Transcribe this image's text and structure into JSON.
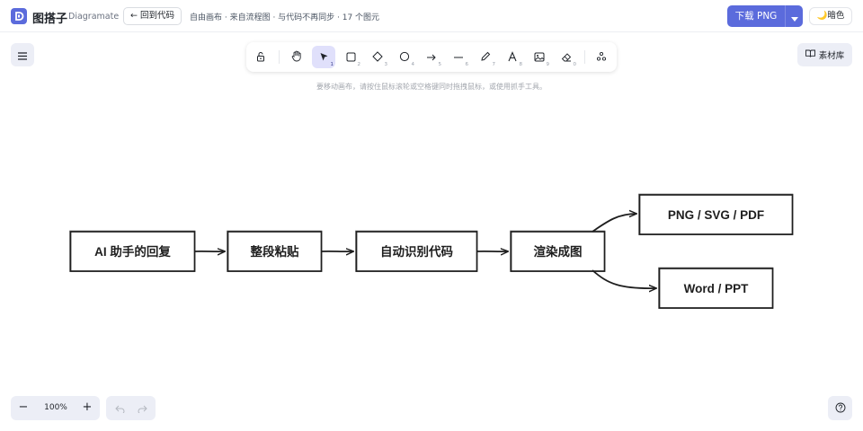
{
  "header": {
    "app_name": "图搭子",
    "app_subtitle": "Diagramate",
    "back_label": "← 回到代码",
    "status": "自由画布 · 来自流程图 · 与代码不再同步 · 17 个图元",
    "download_label": "下载 PNG",
    "theme_label": "暗色",
    "theme_icon": "moon-icon"
  },
  "library": {
    "label": "素材库",
    "icon": "book-icon"
  },
  "toolbar": {
    "tools": [
      {
        "name": "lock",
        "icon": "lock-open-icon",
        "shortcut": ""
      },
      {
        "name": "hand",
        "icon": "hand-icon",
        "shortcut": ""
      },
      {
        "name": "select",
        "icon": "cursor-icon",
        "shortcut": "1",
        "active": true
      },
      {
        "name": "rectangle",
        "icon": "rectangle-icon",
        "shortcut": "2"
      },
      {
        "name": "diamond",
        "icon": "diamond-icon",
        "shortcut": "3"
      },
      {
        "name": "ellipse",
        "icon": "ellipse-icon",
        "shortcut": "4"
      },
      {
        "name": "arrow",
        "icon": "arrow-icon",
        "shortcut": "5"
      },
      {
        "name": "line",
        "icon": "line-icon",
        "shortcut": "6"
      },
      {
        "name": "draw",
        "icon": "pencil-icon",
        "shortcut": "7"
      },
      {
        "name": "text",
        "icon": "text-icon",
        "shortcut": "8"
      },
      {
        "name": "image",
        "icon": "image-icon",
        "shortcut": "9"
      },
      {
        "name": "eraser",
        "icon": "eraser-icon",
        "shortcut": "0"
      },
      {
        "name": "more",
        "icon": "shapes-icon",
        "shortcut": ""
      }
    ],
    "hint": "要移动画布，请按住鼠标滚轮或空格键同时拖拽鼠标，或使用抓手工具。"
  },
  "diagram": {
    "nodes": [
      {
        "id": "n1",
        "label": "AI 助手的回复"
      },
      {
        "id": "n2",
        "label": "整段粘贴"
      },
      {
        "id": "n3",
        "label": "自动识别代码"
      },
      {
        "id": "n4",
        "label": "渲染成图"
      },
      {
        "id": "n5",
        "label": "PNG / SVG / PDF"
      },
      {
        "id": "n6",
        "label": "Word / PPT"
      }
    ],
    "edges": [
      {
        "from": "n1",
        "to": "n2"
      },
      {
        "from": "n2",
        "to": "n3"
      },
      {
        "from": "n3",
        "to": "n4"
      },
      {
        "from": "n4",
        "to": "n5"
      },
      {
        "from": "n4",
        "to": "n6"
      }
    ]
  },
  "footer": {
    "zoom_out": "−",
    "zoom_level": "100%",
    "zoom_in": "+"
  },
  "colors": {
    "accent": "#5b6bdc",
    "ink": "#1e1e1e",
    "panel": "#eceef6"
  }
}
